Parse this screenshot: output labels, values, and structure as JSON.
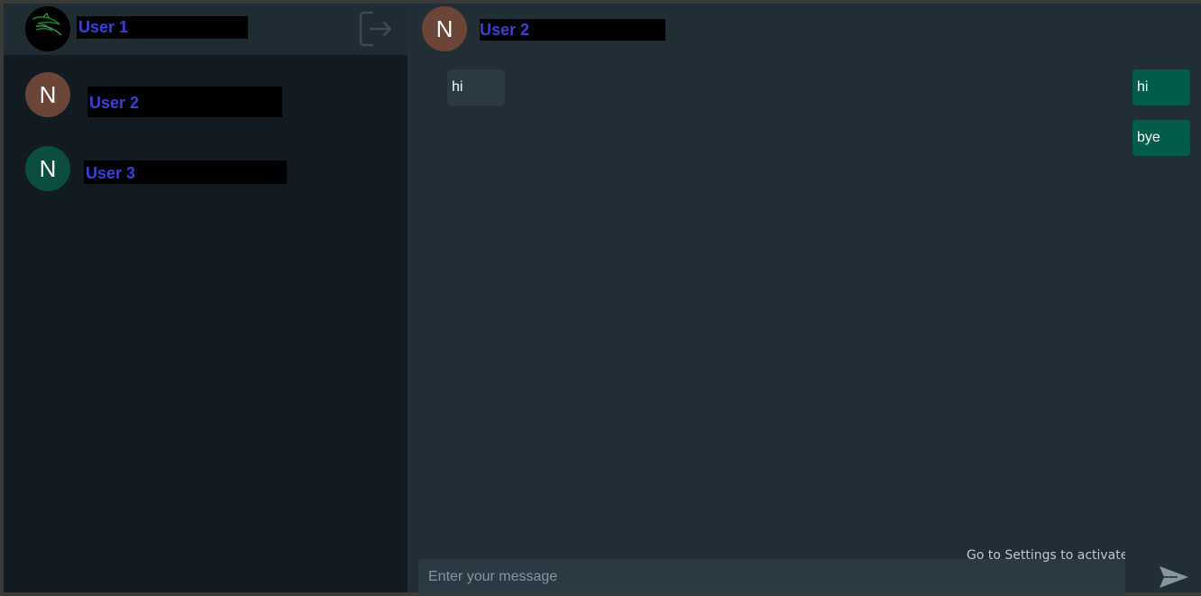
{
  "colors": {
    "sidebar_bg": "#111b21",
    "header_bg": "#202c33",
    "chat_bg": "#222e35",
    "incoming_bubble": "#2a3942",
    "outgoing_bubble": "#005c4b",
    "name_text": "#3b3fd8",
    "avatar_brown": "#6b4537",
    "avatar_green": "#0b4d3e"
  },
  "sidebar": {
    "me": {
      "name": "User 1",
      "avatar_icon": "dragon-logo-icon"
    },
    "logout_icon": "logout-icon",
    "contacts": [
      {
        "name": "User 2",
        "initial": "N",
        "avatar_color": "#6b4537"
      },
      {
        "name": "User 3",
        "initial": "N",
        "avatar_color": "#0b4d3e"
      }
    ]
  },
  "chat": {
    "header": {
      "name": "User 2",
      "initial": "N",
      "avatar_color": "#6b4537"
    },
    "messages": [
      {
        "direction": "incoming",
        "text": "hi"
      },
      {
        "direction": "outgoing",
        "text": "hi"
      },
      {
        "direction": "outgoing",
        "text": "bye"
      }
    ],
    "composer": {
      "placeholder": "Enter your message",
      "value": ""
    },
    "send_icon": "send-arrow-icon"
  },
  "overlay": {
    "activation_watermark": "Go to Settings to activate Windows."
  }
}
